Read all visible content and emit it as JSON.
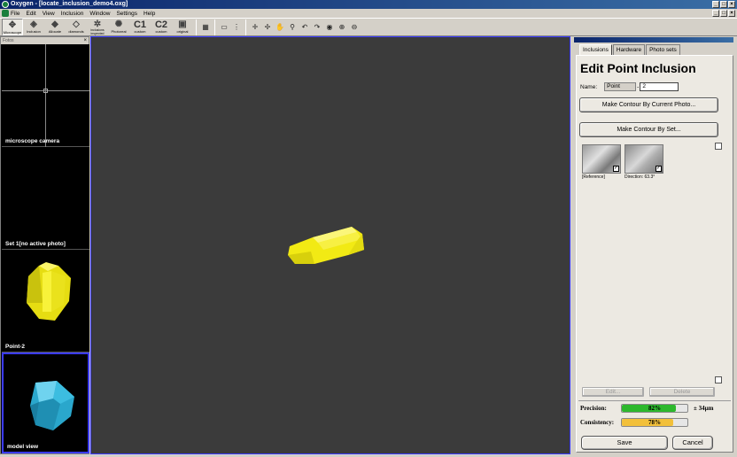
{
  "window": {
    "title": "Oxygen - [locate_inclusion_demo4.oxg]"
  },
  "menu": [
    "File",
    "Edit",
    "View",
    "Inclusion",
    "Window",
    "Settings",
    "Help"
  ],
  "toolbar": {
    "buttons": [
      {
        "label": "Microscope",
        "icon": "microscope-icon",
        "glyph": "✥"
      },
      {
        "label": "Inclusion",
        "icon": "inclusion-icon",
        "glyph": "◈"
      },
      {
        "label": "Allocate",
        "icon": "allocate-icon",
        "glyph": "◆"
      },
      {
        "label": "diamonds",
        "icon": "diamonds-icon",
        "glyph": "◇"
      },
      {
        "label": "inclusions inspected",
        "icon": "inclusions-inspected-icon",
        "glyph": "✲"
      },
      {
        "label": "Photoreal",
        "icon": "photoreal-icon",
        "glyph": "✺"
      },
      {
        "label": "custom",
        "icon": "custom1-icon",
        "glyph": "C1"
      },
      {
        "label": "custom",
        "icon": "custom2-icon",
        "glyph": "C2"
      },
      {
        "label": "original",
        "icon": "original-icon",
        "glyph": "▣"
      }
    ],
    "small_icons": [
      {
        "icon": "layout-grid-icon",
        "glyph": "▦"
      },
      {
        "icon": "layout-single-icon",
        "glyph": "▭"
      },
      {
        "icon": "divider-icon",
        "glyph": "⋮"
      },
      {
        "icon": "move-icon",
        "glyph": "✛"
      },
      {
        "icon": "pan-icon",
        "glyph": "✢"
      },
      {
        "icon": "hand-icon",
        "glyph": "✋"
      },
      {
        "icon": "stamp-icon",
        "glyph": "⚲"
      },
      {
        "icon": "rotate-icon",
        "glyph": "↶"
      },
      {
        "icon": "rotate-back-icon",
        "glyph": "↷"
      },
      {
        "icon": "eye-icon",
        "glyph": "◉"
      },
      {
        "icon": "zoom-in-icon",
        "glyph": "⊕"
      },
      {
        "icon": "zoom-out-icon",
        "glyph": "⊖"
      }
    ]
  },
  "left_panel": {
    "header": "Fotos",
    "thumbs": [
      {
        "label": "microscope camera"
      },
      {
        "label": "Set 1[no active photo]"
      },
      {
        "label": "Point-2"
      },
      {
        "label": "model view"
      }
    ]
  },
  "right_panel": {
    "tabs": [
      "Inclusions",
      "Hardware",
      "Photo sets"
    ],
    "title": "Edit Point Inclusion",
    "name_label": "Name:",
    "name_prefix": "Point",
    "name_dash": "-",
    "name_value": "2",
    "btn_contour_photo": "Make Contour By Current Photo...",
    "btn_contour_set": "Make Contour By Set...",
    "photos": [
      {
        "caption": "[Reference]",
        "checked": "✓"
      },
      {
        "caption": "Direction: 63.3°",
        "checked": "✓"
      }
    ],
    "btn_edit": "Edit...",
    "btn_delete": "Delete",
    "precision_label": "Precision:",
    "precision_value": 82,
    "precision_text": "82%",
    "precision_extra": "± 34µm",
    "consistency_label": "Consistency:",
    "consistency_value": 78,
    "consistency_text": "78%",
    "btn_save": "Save",
    "btn_cancel": "Cancel"
  },
  "colors": {
    "precision_fill": "#2db82d",
    "consistency_fill": "#f2c03a",
    "model_yellow": "#f5ef1a",
    "model_cyan": "#2fb4d6"
  }
}
